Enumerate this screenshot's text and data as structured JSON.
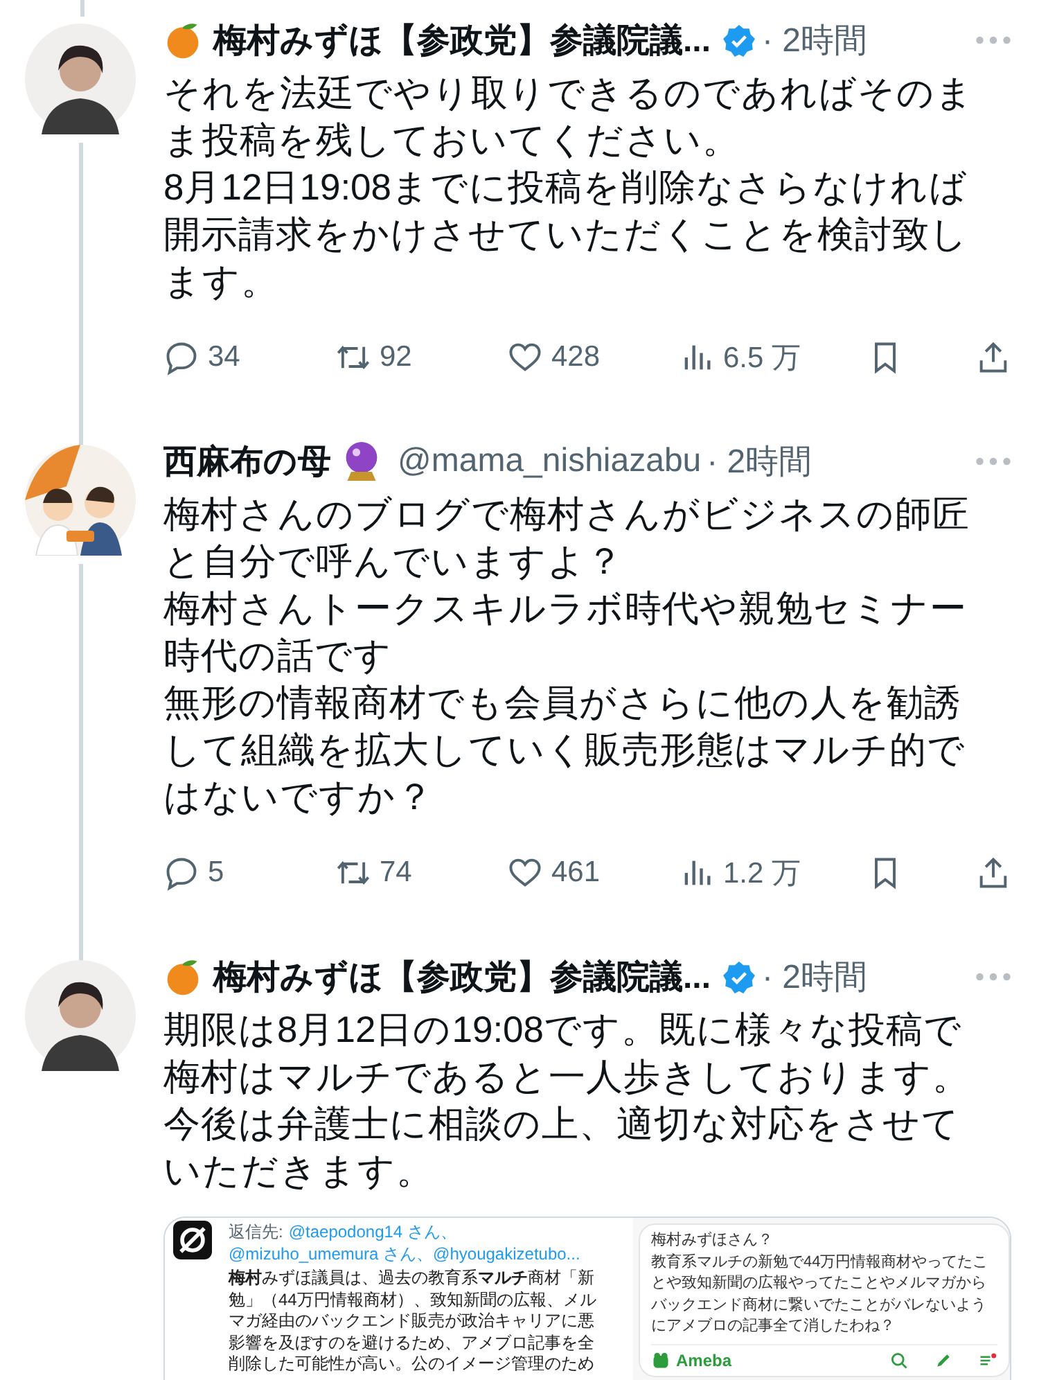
{
  "tweets": [
    {
      "author": "梅村みずほ【参政党】参議院議...",
      "verified": true,
      "time": "· 2時間",
      "paragraphs": [
        "それを法廷でやり取りできるのであればそのまま投稿を残しておいてください。",
        "8月12日19:08までに投稿を削除なさらなければ開示請求をかけさせていただくことを検討致します。"
      ],
      "stats": {
        "replies": "34",
        "retweets": "92",
        "likes": "428",
        "views": "6.5 万"
      }
    },
    {
      "author": "西麻布の母",
      "handle": "@mama_nishiazabu",
      "verified": false,
      "time": "· 2時間",
      "paragraphs": [
        "梅村さんのブログで梅村さんがビジネスの師匠と自分で呼んでいますよ？",
        "梅村さんトークスキルラボ時代や親勉セミナー時代の話です",
        "無形の情報商材でも会員がさらに他の人を勧誘して組織を拡大していく販売形態はマルチ的ではないですか？"
      ],
      "stats": {
        "replies": "5",
        "retweets": "74",
        "likes": "461",
        "views": "1.2 万"
      }
    },
    {
      "author": "梅村みずほ【参政党】参議院議...",
      "verified": true,
      "time": "· 2時間",
      "paragraphs": [
        "期限は8月12日の19:08です。既に様々な投稿で梅村はマルチであると一人歩きしております。今後は弁護士に相談の上、適切な対応をさせていただきます。"
      ],
      "attachment": {
        "left": {
          "reply_label": "返信先:",
          "mentions": [
            "@taepodong14 さん、",
            "@mizuho_umemura さん、@hyougakizetubo..."
          ],
          "body": "**梅村**みずほ議員は、過去の教育系**マルチ**商材「新勉」（44万円情報商材）、致知新聞の広報、メルマガ経由のバックエンド販売が政治キャリアに悪影響を及ぼすのを避けるため、アメブロ記事を全削除した可能性が高い。公のイメージ管理のため"
        },
        "right": {
          "paragraphs": [
            "梅村みずほさん？",
            "教育系マルチの新勉で44万円情報商材やってたことや致知新聞の広報やってたことやメルマガからバックエンド商材に繋いでたことがバレないようにアメブロの記事全て消したわね？"
          ],
          "brand": "Ameba"
        }
      }
    }
  ]
}
